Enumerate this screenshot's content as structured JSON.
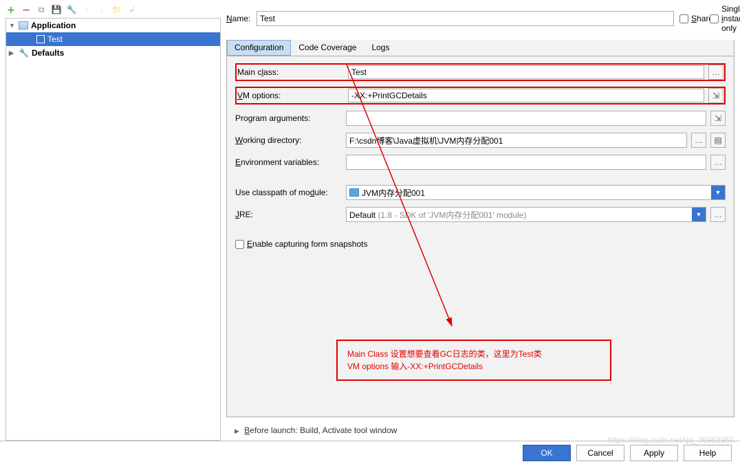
{
  "header": {
    "name_label": "Name:",
    "name_value": "Test",
    "share_label": "Share",
    "single_instance_label": "Single instance only"
  },
  "tree": {
    "app_label": "Application",
    "app_item": "Test",
    "defaults_label": "Defaults"
  },
  "tabs": {
    "configuration": "Configuration",
    "code_coverage": "Code Coverage",
    "logs": "Logs"
  },
  "form": {
    "main_class_label": "Main class:",
    "main_class_value": "Test",
    "vm_options_label": "VM options:",
    "vm_options_value": "-XX:+PrintGCDetails",
    "program_args_label": "Program arguments:",
    "program_args_value": "",
    "working_dir_label": "Working directory:",
    "working_dir_value": "F:\\csdn博客\\Java虚拟机\\JVM内存分配001",
    "env_vars_label": "Environment variables:",
    "env_vars_value": "",
    "classpath_label": "Use classpath of module:",
    "classpath_value": "JVM内存分配001",
    "jre_label": "JRE:",
    "jre_value_prefix": "Default ",
    "jre_value_suffix": "(1.8 - SDK of 'JVM内存分配001' module)",
    "enable_snapshots_label": "Enable capturing form snapshots"
  },
  "before_launch": "Before launch: Build, Activate tool window",
  "annotation": {
    "line1": "Main Class 设置想要查看GC日志的类，这里为Test类",
    "line2": "VM options   输入-XX:+PrintGCDetails"
  },
  "footer": {
    "ok": "OK",
    "cancel": "Cancel",
    "apply": "Apply",
    "help": "Help"
  },
  "watermark": "https://blog.csdn.net/qq_36963950"
}
